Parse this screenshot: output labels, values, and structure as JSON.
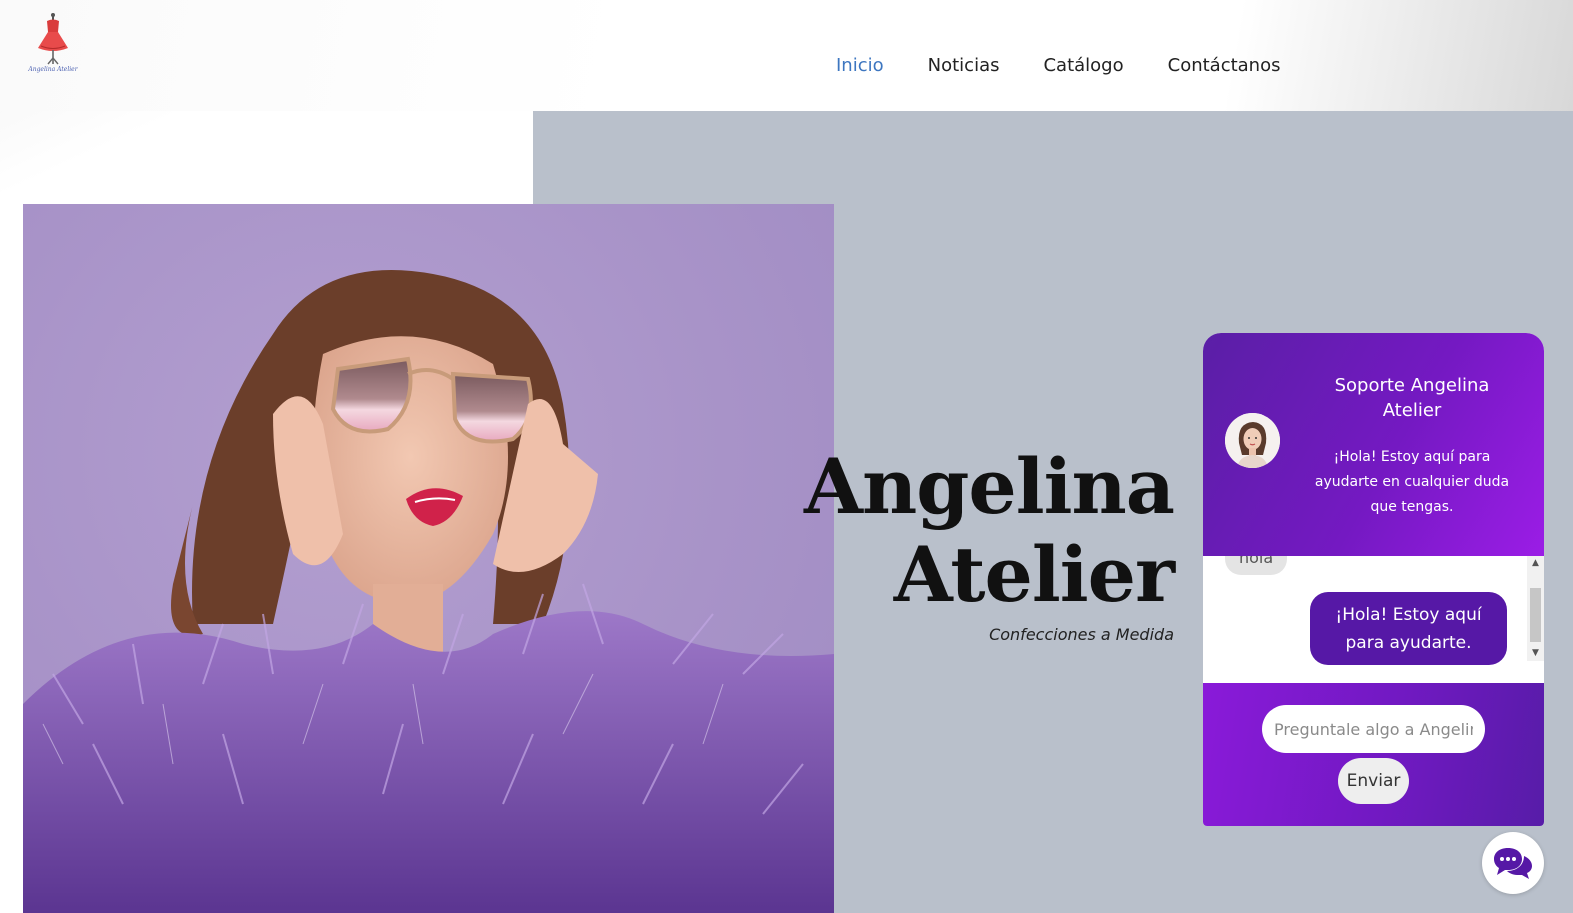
{
  "logo": {
    "text": "Angelina Atelier"
  },
  "nav": {
    "items": [
      {
        "label": "Inicio",
        "active": true
      },
      {
        "label": "Noticias",
        "active": false
      },
      {
        "label": "Catálogo",
        "active": false
      },
      {
        "label": "Contáctanos",
        "active": false
      }
    ],
    "active_color": "#3d76c0"
  },
  "hero": {
    "title_line1": "Angelina",
    "title_line2": "Atelier",
    "subtitle": "Confecciones a Medida"
  },
  "chat": {
    "title": "Soporte Angelina Atelier",
    "greeting": "¡Hola! Estoy aquí para ayudarte en cualquier duda que tengas.",
    "messages": [
      {
        "from": "user",
        "text": "hola"
      },
      {
        "from": "bot",
        "text": "¡Hola! Estoy aquí para ayudarte."
      }
    ],
    "input": {
      "placeholder": "Preguntale algo a Angelina",
      "value": ""
    },
    "send_label": "Enviar",
    "launcher_icon": "chat-bubbles-icon",
    "colors": {
      "header": "#7419c2",
      "bot_bubble": "#5618a6",
      "footer": "#7119c2"
    }
  },
  "colors": {
    "gray_panel": "#b9c0cb",
    "hero_bg": "#a893c8"
  }
}
